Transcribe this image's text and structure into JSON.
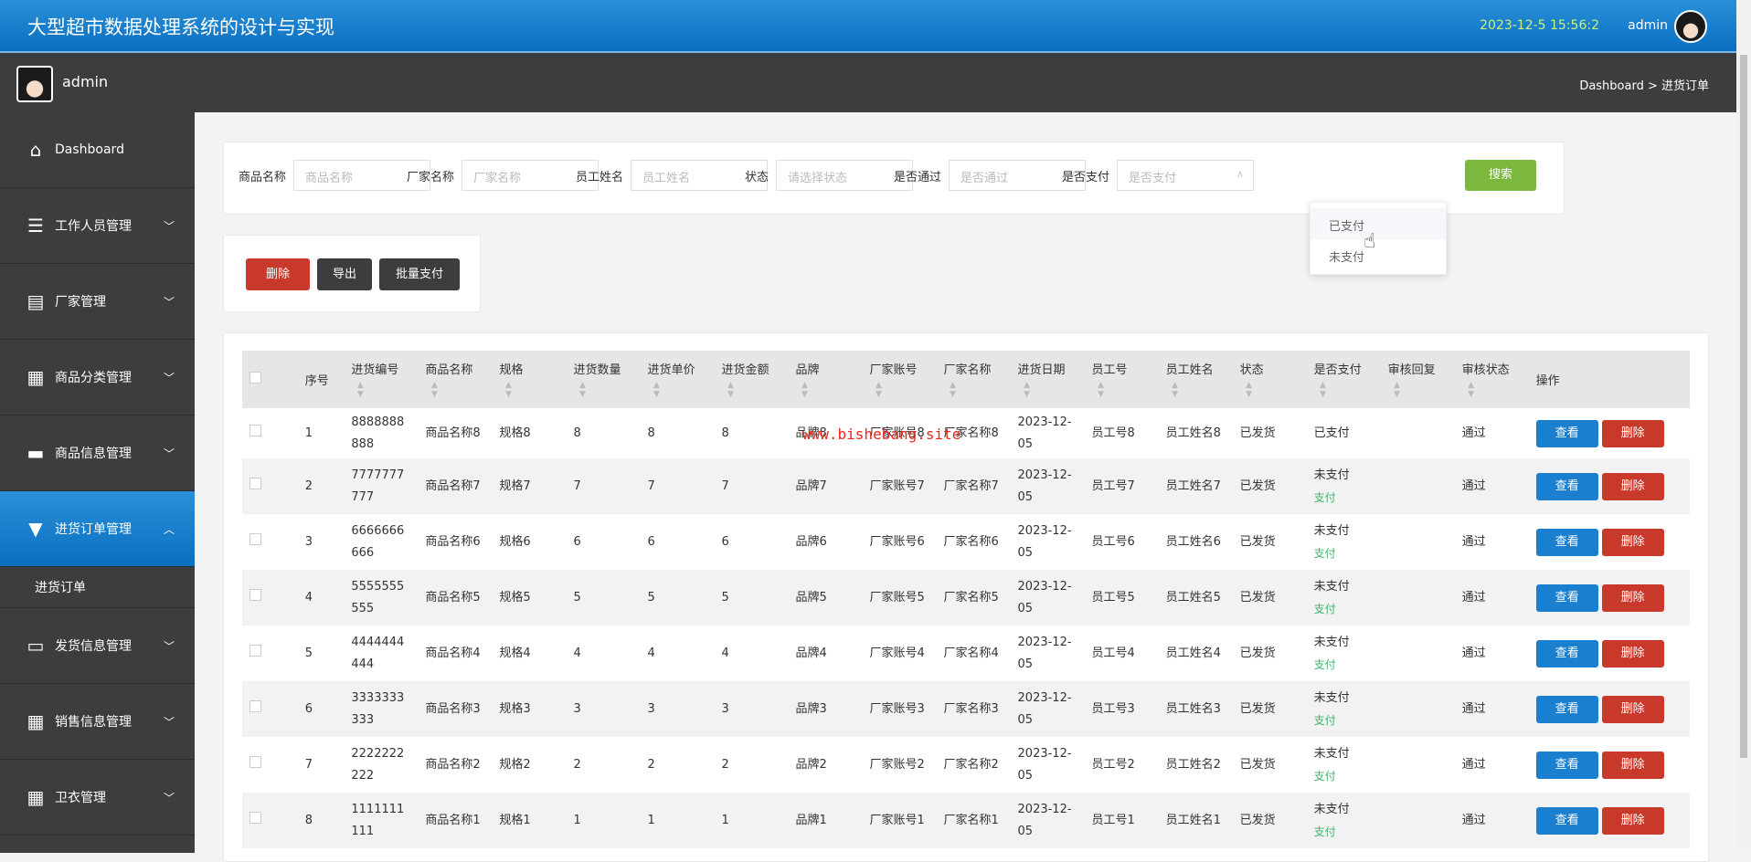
{
  "header": {
    "title": "大型超市数据处理系统的设计与实现",
    "datetime": "2023-12-5 15:56:2",
    "user": "admin"
  },
  "subbar": {
    "user": "admin",
    "breadcrumb": "Dashboard > 进货订单"
  },
  "sidebar": {
    "items": [
      {
        "label": "Dashboard",
        "icon": "home-icon"
      },
      {
        "label": "工作人员管理",
        "icon": "sliders-icon"
      },
      {
        "label": "厂家管理",
        "icon": "store-icon"
      },
      {
        "label": "商品分类管理",
        "icon": "grid-icon"
      },
      {
        "label": "商品信息管理",
        "icon": "ticket-icon"
      },
      {
        "label": "进货订单管理",
        "icon": "paint-roller-icon",
        "active": true,
        "sub": [
          "进货订单"
        ]
      },
      {
        "label": "发货信息管理",
        "icon": "briefcase-icon"
      },
      {
        "label": "销售信息管理",
        "icon": "grid-icon"
      },
      {
        "label": "卫衣管理",
        "icon": "grid-icon"
      }
    ]
  },
  "search": {
    "fields": [
      {
        "label": "商品名称",
        "placeholder": "商品名称"
      },
      {
        "label": "厂家名称",
        "placeholder": "厂家名称"
      },
      {
        "label": "员工姓名",
        "placeholder": "员工姓名"
      }
    ],
    "selects": [
      {
        "label": "状态",
        "placeholder": "请选择状态"
      },
      {
        "label": "是否通过",
        "placeholder": "是否通过"
      },
      {
        "label": "是否支付",
        "placeholder": "是否支付",
        "open": true
      }
    ],
    "button": "搜索",
    "dropdown_options": [
      "已支付",
      "未支付"
    ]
  },
  "actions": {
    "delete": "删除",
    "export": "导出",
    "batch_pay": "批量支付"
  },
  "watermark": "www.bishebang.site",
  "table": {
    "columns": [
      "序号",
      "进货编号",
      "商品名称",
      "规格",
      "进货数量",
      "进货单价",
      "进货金额",
      "品牌",
      "厂家账号",
      "厂家名称",
      "进货日期",
      "员工号",
      "员工姓名",
      "状态",
      "是否支付",
      "审核回复",
      "审核状态",
      "操作"
    ],
    "rows": [
      {
        "no": "1",
        "code": "8888888888",
        "goods": "商品名称8",
        "spec": "规格8",
        "qty": "8",
        "price": "8",
        "amount": "8",
        "brand": "品牌8",
        "acct": "厂家账号8",
        "vendor": "厂家名称8",
        "date": "2023-12-05",
        "empno": "员工号8",
        "emp": "员工姓名8",
        "status": "已发货",
        "paid": "已支付",
        "pay_link": "",
        "reply": "",
        "audit": "通过"
      },
      {
        "no": "2",
        "code": "7777777777",
        "goods": "商品名称7",
        "spec": "规格7",
        "qty": "7",
        "price": "7",
        "amount": "7",
        "brand": "品牌7",
        "acct": "厂家账号7",
        "vendor": "厂家名称7",
        "date": "2023-12-05",
        "empno": "员工号7",
        "emp": "员工姓名7",
        "status": "已发货",
        "paid": "未支付",
        "pay_link": "支付",
        "reply": "",
        "audit": "通过"
      },
      {
        "no": "3",
        "code": "6666666666",
        "goods": "商品名称6",
        "spec": "规格6",
        "qty": "6",
        "price": "6",
        "amount": "6",
        "brand": "品牌6",
        "acct": "厂家账号6",
        "vendor": "厂家名称6",
        "date": "2023-12-05",
        "empno": "员工号6",
        "emp": "员工姓名6",
        "status": "已发货",
        "paid": "未支付",
        "pay_link": "支付",
        "reply": "",
        "audit": "通过"
      },
      {
        "no": "4",
        "code": "5555555555",
        "goods": "商品名称5",
        "spec": "规格5",
        "qty": "5",
        "price": "5",
        "amount": "5",
        "brand": "品牌5",
        "acct": "厂家账号5",
        "vendor": "厂家名称5",
        "date": "2023-12-05",
        "empno": "员工号5",
        "emp": "员工姓名5",
        "status": "已发货",
        "paid": "未支付",
        "pay_link": "支付",
        "reply": "",
        "audit": "通过"
      },
      {
        "no": "5",
        "code": "4444444444",
        "goods": "商品名称4",
        "spec": "规格4",
        "qty": "4",
        "price": "4",
        "amount": "4",
        "brand": "品牌4",
        "acct": "厂家账号4",
        "vendor": "厂家名称4",
        "date": "2023-12-05",
        "empno": "员工号4",
        "emp": "员工姓名4",
        "status": "已发货",
        "paid": "未支付",
        "pay_link": "支付",
        "reply": "",
        "audit": "通过"
      },
      {
        "no": "6",
        "code": "3333333333",
        "goods": "商品名称3",
        "spec": "规格3",
        "qty": "3",
        "price": "3",
        "amount": "3",
        "brand": "品牌3",
        "acct": "厂家账号3",
        "vendor": "厂家名称3",
        "date": "2023-12-05",
        "empno": "员工号3",
        "emp": "员工姓名3",
        "status": "已发货",
        "paid": "未支付",
        "pay_link": "支付",
        "reply": "",
        "audit": "通过"
      },
      {
        "no": "7",
        "code": "2222222222",
        "goods": "商品名称2",
        "spec": "规格2",
        "qty": "2",
        "price": "2",
        "amount": "2",
        "brand": "品牌2",
        "acct": "厂家账号2",
        "vendor": "厂家名称2",
        "date": "2023-12-05",
        "empno": "员工号2",
        "emp": "员工姓名2",
        "status": "已发货",
        "paid": "未支付",
        "pay_link": "支付",
        "reply": "",
        "audit": "通过"
      },
      {
        "no": "8",
        "code": "1111111111",
        "goods": "商品名称1",
        "spec": "规格1",
        "qty": "1",
        "price": "1",
        "amount": "1",
        "brand": "品牌1",
        "acct": "厂家账号1",
        "vendor": "厂家名称1",
        "date": "2023-12-05",
        "empno": "员工号1",
        "emp": "员工姓名1",
        "status": "已发货",
        "paid": "未支付",
        "pay_link": "支付",
        "reply": "",
        "audit": "通过"
      }
    ],
    "view_label": "查看",
    "delete_label": "删除"
  },
  "colors": {
    "primary": "#1a7fcf",
    "danger": "#c9392b",
    "success": "#7cb83e",
    "dark": "#3b3d3f",
    "date": "#c9f27a"
  }
}
